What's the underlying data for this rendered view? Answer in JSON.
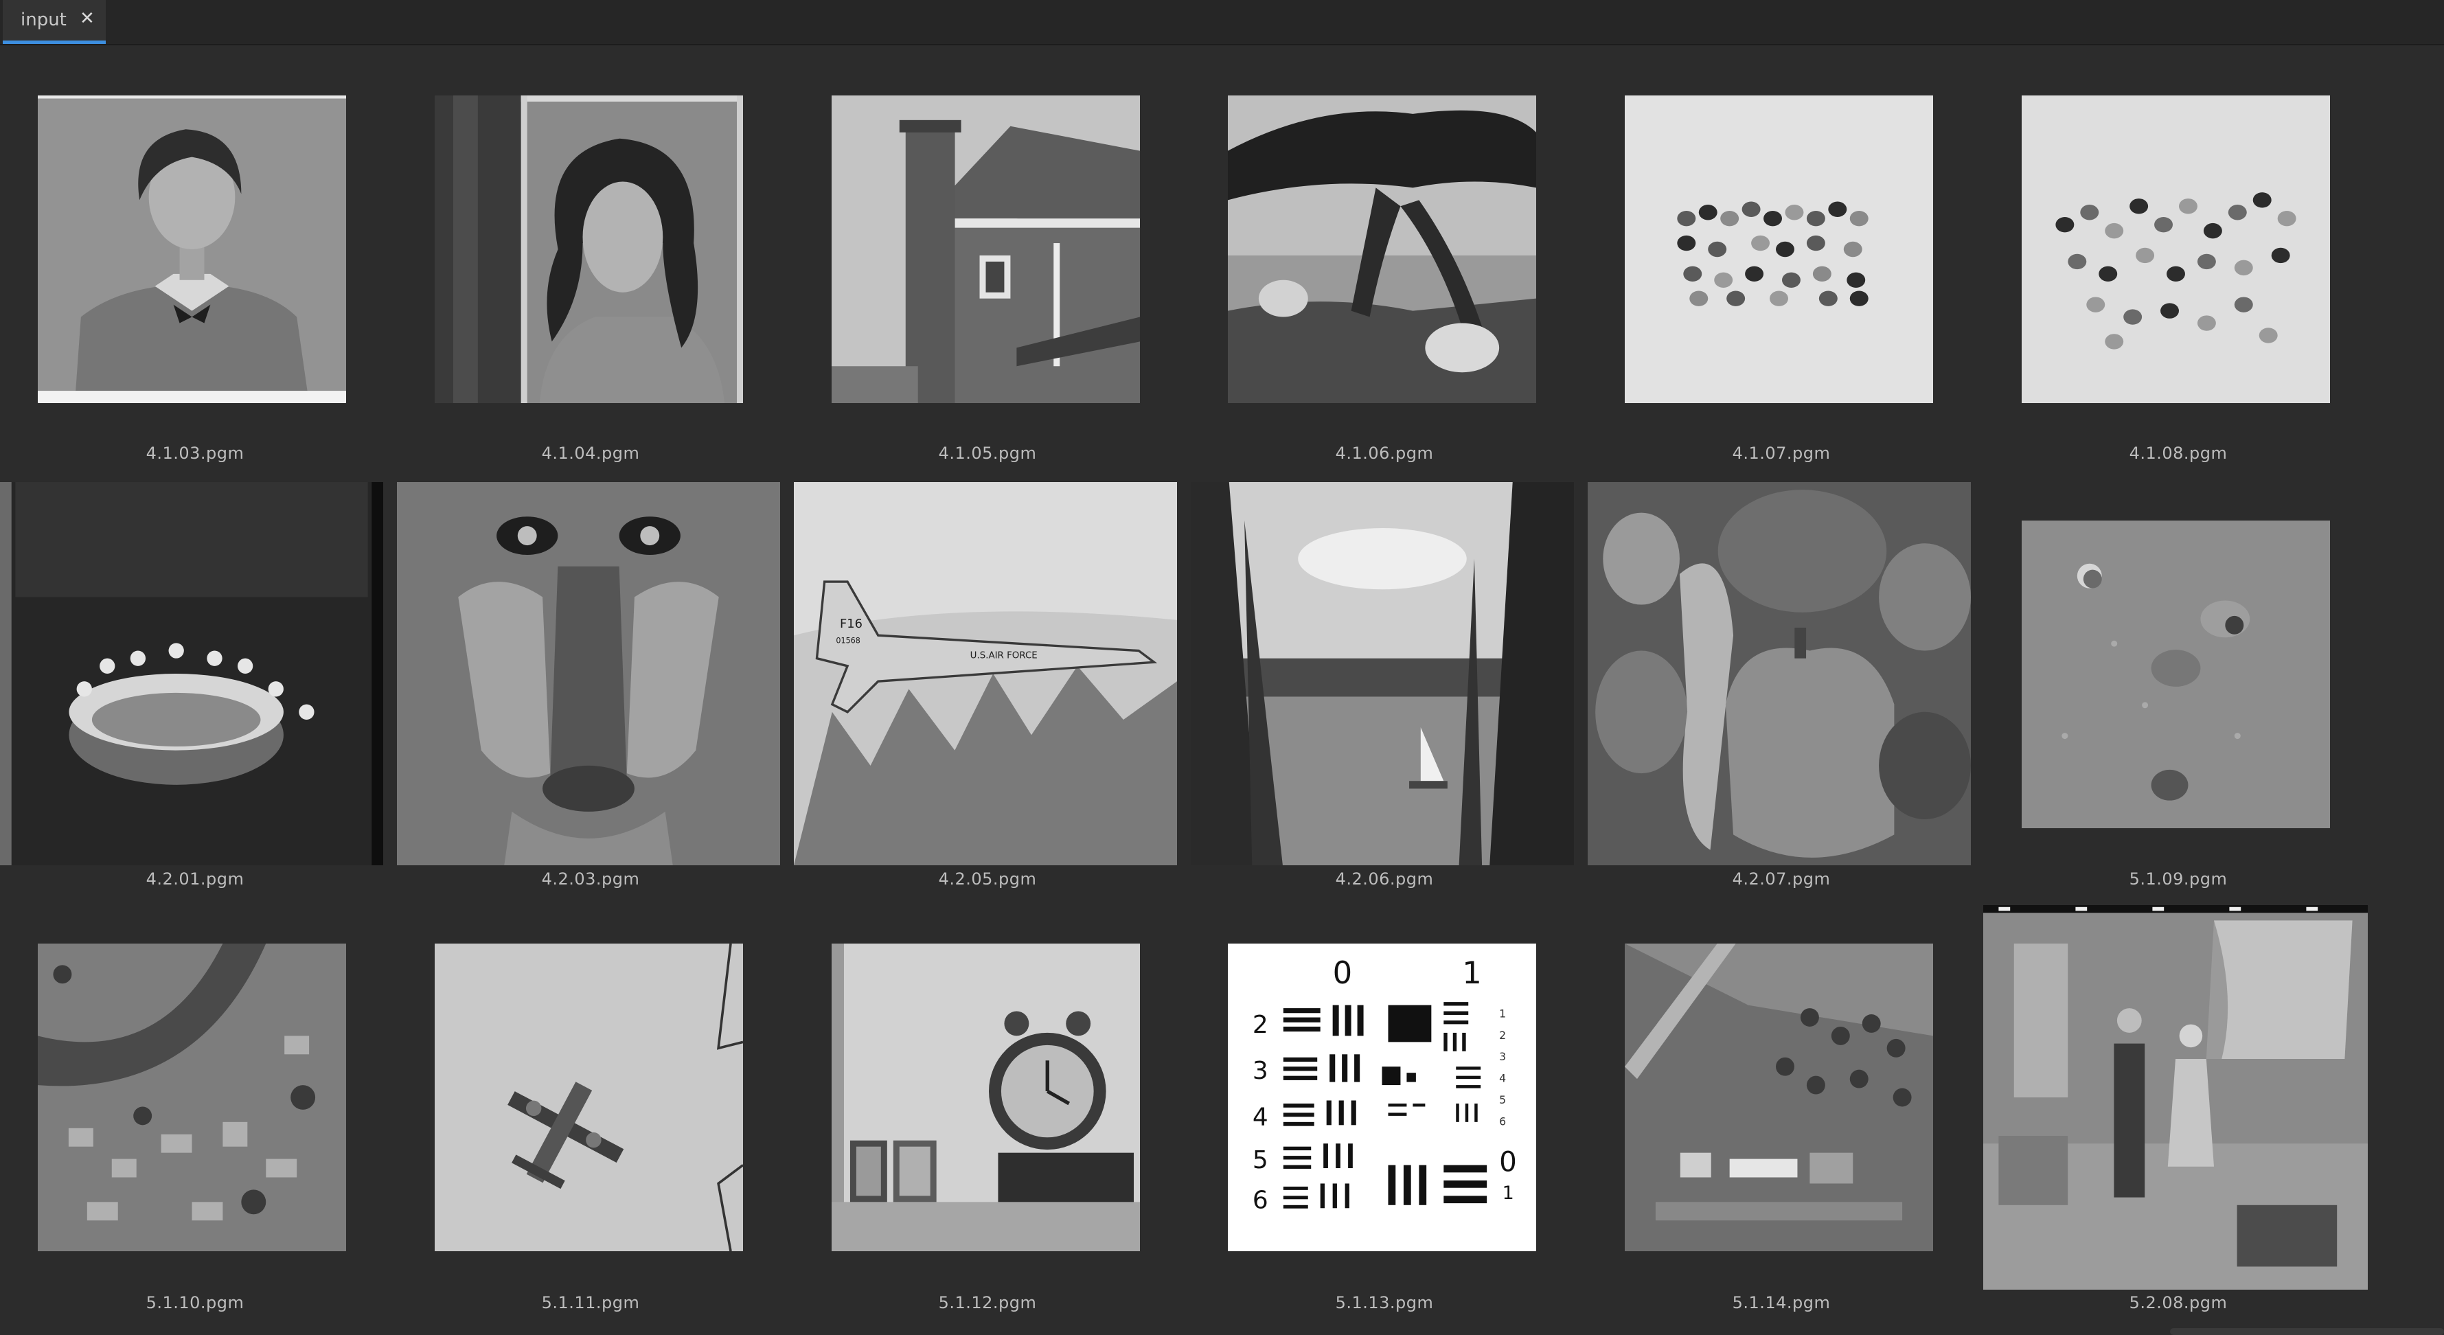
{
  "tab": {
    "label": "input",
    "close_glyph": "✕"
  },
  "captions": {
    "c0": "4.1.03.pgm",
    "c1": "4.1.04.pgm",
    "c2": "4.1.05.pgm",
    "c3": "4.1.06.pgm",
    "c4": "4.1.07.pgm",
    "c5": "4.1.08.pgm",
    "c6": "4.2.01.pgm",
    "c7": "4.2.03.pgm",
    "c8": "4.2.05.pgm",
    "c9": "4.2.06.pgm",
    "c10": "4.2.07.pgm",
    "c11": "5.1.09.pgm",
    "c12": "5.1.10.pgm",
    "c13": "5.1.11.pgm",
    "c14": "5.1.12.pgm",
    "c15": "5.1.13.pgm",
    "c16": "5.1.14.pgm",
    "c17": "5.2.08.pgm"
  },
  "plane_text": {
    "tail": "F16",
    "serial": "01568",
    "side": "U.S.AIR FORCE"
  },
  "chart_text": {
    "top": [
      "0",
      "1"
    ],
    "left": [
      "2",
      "3",
      "4",
      "5",
      "6"
    ],
    "group_right": [
      "1",
      "2",
      "3",
      "4",
      "5",
      "6"
    ],
    "bottom_right": [
      "0",
      "1"
    ]
  }
}
